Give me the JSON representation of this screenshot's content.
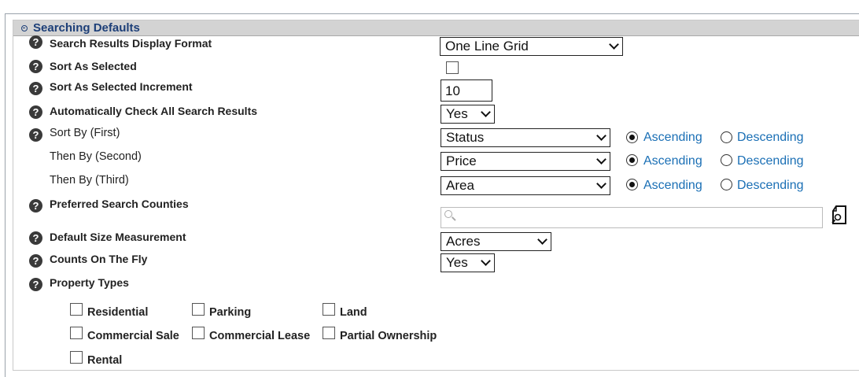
{
  "section": {
    "title": "Searching Defaults"
  },
  "fields": {
    "display_format": {
      "label": "Search Results Display Format",
      "value": "One Line Grid"
    },
    "sort_as_selected": {
      "label": "Sort As Selected",
      "checked": false
    },
    "sort_increment": {
      "label": "Sort As Selected Increment",
      "value": "10"
    },
    "auto_check": {
      "label": "Automatically Check All Search Results",
      "value": "Yes"
    },
    "sort_first": {
      "label": "Sort By (First)",
      "value": "Status",
      "order": "Ascending"
    },
    "sort_second": {
      "label": "Then By (Second)",
      "value": "Price",
      "order": "Ascending"
    },
    "sort_third": {
      "label": "Then By (Third)",
      "value": "Area",
      "order": "Ascending"
    },
    "counties": {
      "label": "Preferred Search Counties",
      "value": ""
    },
    "size_measurement": {
      "label": "Default Size Measurement",
      "value": "Acres"
    },
    "counts_on_fly": {
      "label": "Counts On The Fly",
      "value": "Yes"
    },
    "property_types": {
      "label": "Property Types"
    }
  },
  "sort_order": {
    "ascending": "Ascending",
    "descending": "Descending"
  },
  "property_types": {
    "residential": "Residential",
    "parking": "Parking",
    "land": "Land",
    "commercial_sale": "Commercial Sale",
    "commercial_lease": "Commercial Lease",
    "partial_ownership": "Partial Ownership",
    "rental": "Rental"
  },
  "icons": {
    "help": "?",
    "help_icon": "help-icon",
    "lookup": "lookup-icon"
  },
  "colors": {
    "header_bg": "#d3d3d3",
    "title": "#1d3f78",
    "radio_label": "#1a6fb5"
  }
}
